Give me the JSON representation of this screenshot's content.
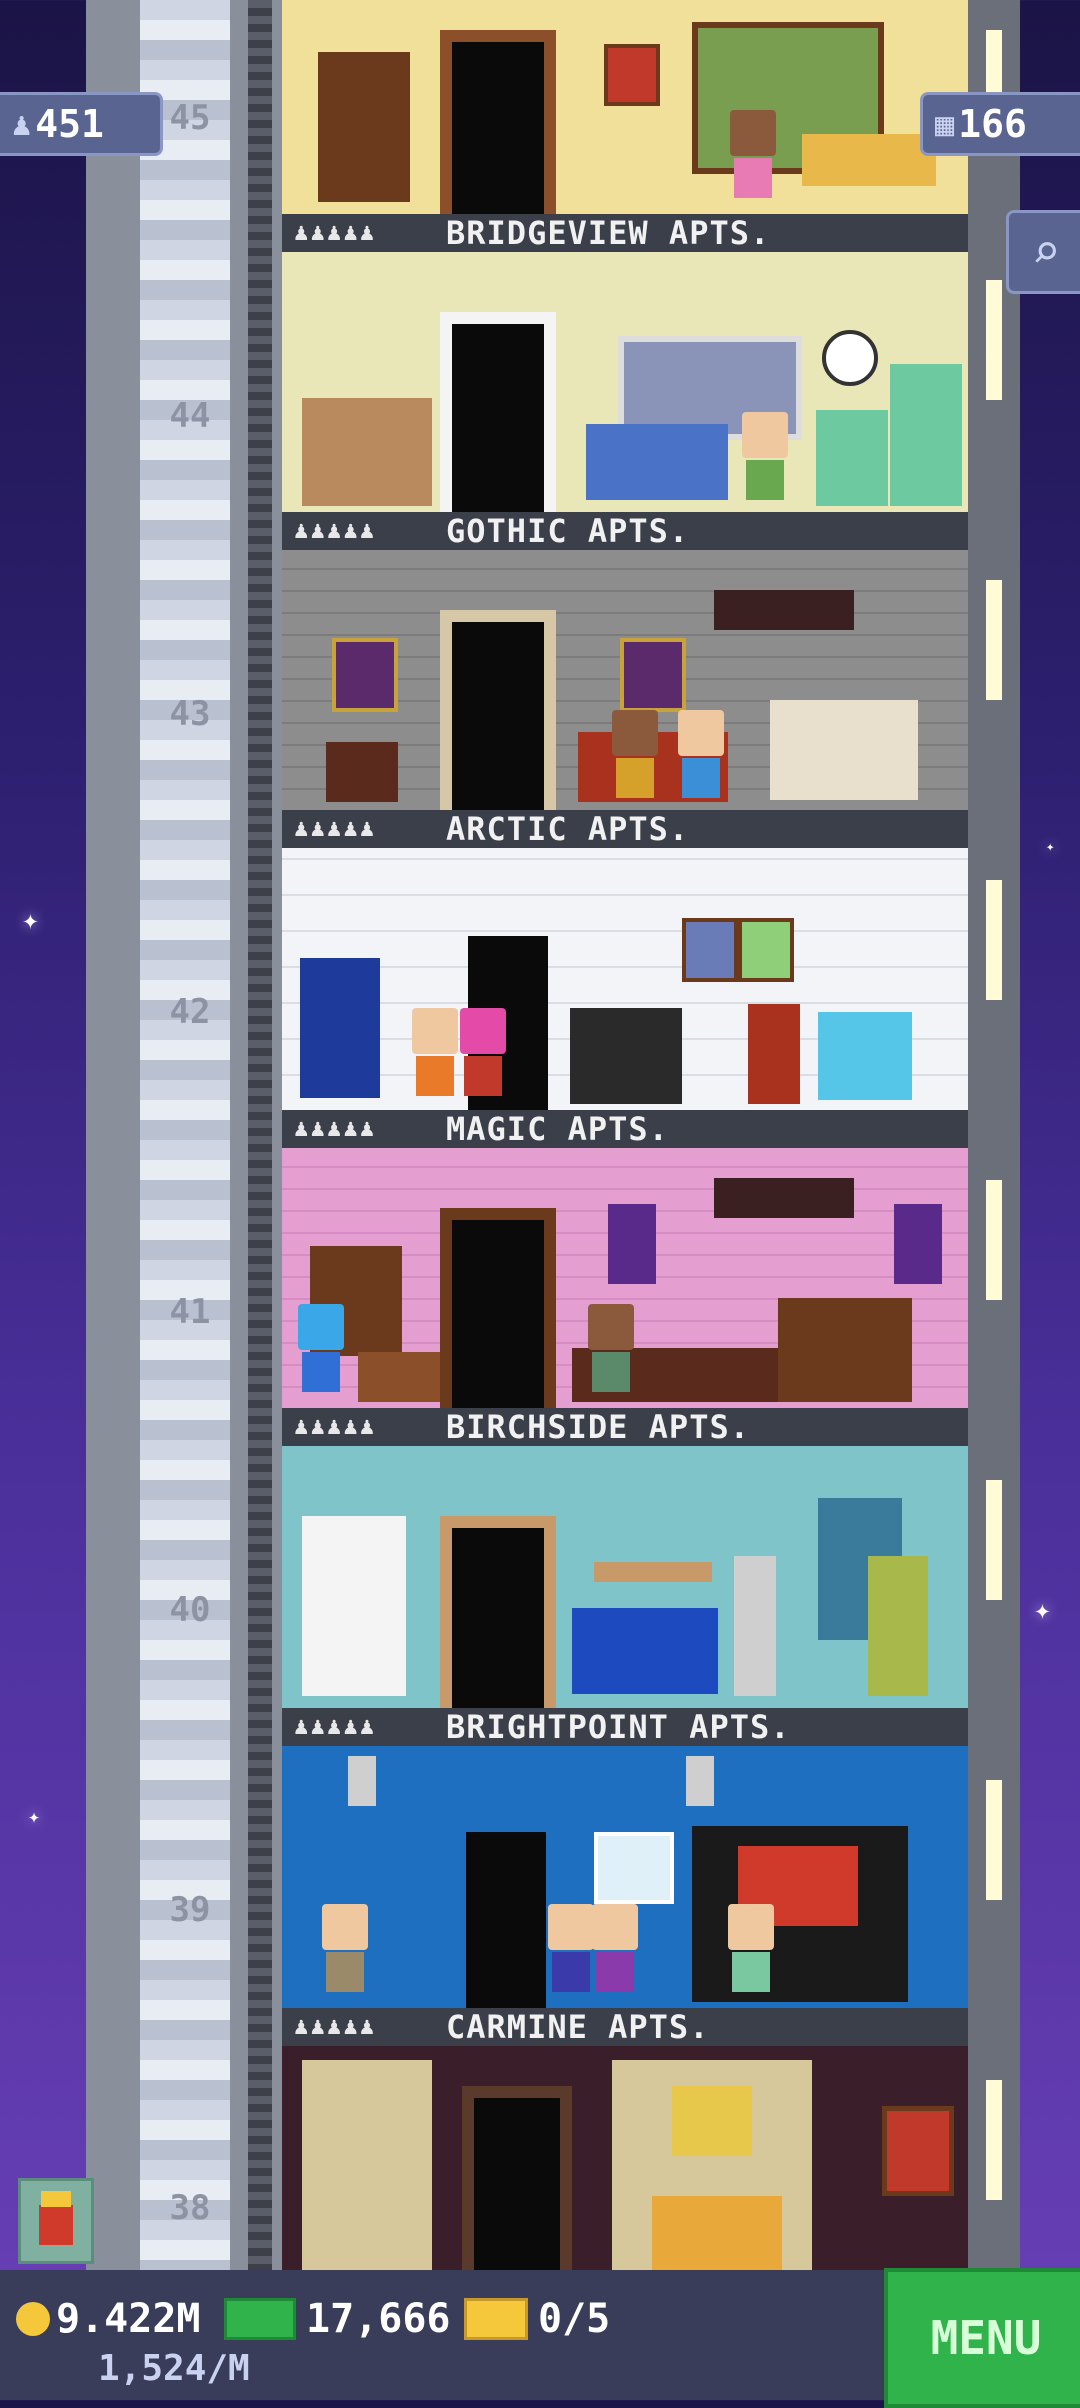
{
  "header": {
    "population": "451",
    "floors": "166"
  },
  "floors": [
    {
      "number": "45",
      "name": "BRIDGEVIEW APTS.",
      "residents_icon": "♟♟♟♟♟"
    },
    {
      "number": "44",
      "name": "GOTHIC APTS.",
      "residents_icon": "♟♟♟♟♟"
    },
    {
      "number": "43",
      "name": "ARCTIC APTS.",
      "residents_icon": "♟♟♟♟♟"
    },
    {
      "number": "42",
      "name": "MAGIC APTS.",
      "residents_icon": "♟♟♟♟♟"
    },
    {
      "number": "41",
      "name": "BIRCHSIDE APTS.",
      "residents_icon": "♟♟♟♟♟"
    },
    {
      "number": "40",
      "name": "BRIGHTPOINT APTS.",
      "residents_icon": "♟♟♟♟♟"
    },
    {
      "number": "39",
      "name": "CARMINE APTS.",
      "residents_icon": "♟♟♟♟♟"
    },
    {
      "number": "38",
      "name": "",
      "residents_icon": ""
    }
  ],
  "bottom": {
    "coins": "9.422M",
    "coin_rate": "1,524/M",
    "bux": "17,666",
    "tickets": "0/5",
    "menu_label": "MENU"
  },
  "colors": {
    "sky_top": "#1b1446",
    "sky_bottom": "#6a40b8",
    "menu_green": "#2fb34a",
    "sign_bg": "#3b3f49"
  },
  "icons": {
    "population": "person-icon",
    "floors": "building-icon",
    "search": "magnifier-icon",
    "coin": "coin-icon",
    "bux": "bux-icon",
    "ticket": "ticket-icon"
  }
}
